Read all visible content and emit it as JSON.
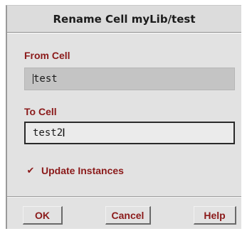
{
  "dialog": {
    "title": "Rename Cell myLib/test",
    "from_cell_label": "From Cell",
    "from_cell_value": "test",
    "to_cell_label": "To Cell",
    "to_cell_value": "test2",
    "update_instances_label": "Update Instances",
    "update_instances_checked": true,
    "ok_label": "OK",
    "cancel_label": "Cancel",
    "help_label": "Help"
  },
  "colors": {
    "label_text": "#8b1a1a",
    "background": "#e2e2e2",
    "readonly_field": "#c4c4c4"
  },
  "icons": {
    "check": "check-icon"
  }
}
